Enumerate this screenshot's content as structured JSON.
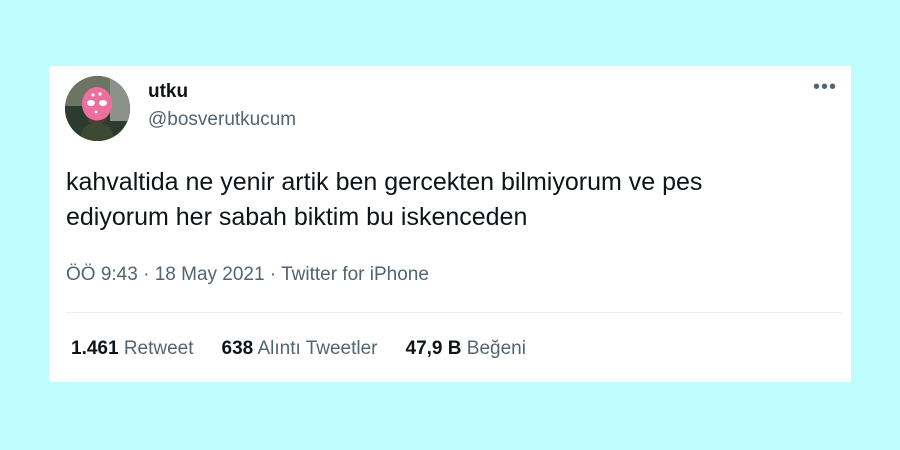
{
  "tweet": {
    "author_name": "utku",
    "author_handle": "@bosverutkucum",
    "more_icon": "more-horizontal-icon",
    "text_line1": "kahvaltida ne yenir artik ben gercekten bilmiyorum ve pes",
    "text_line2": "ediyorum her sabah biktim bu iskenceden",
    "timestamp": "ÖÖ 9:43 · 18 May 2021 · Twitter for iPhone",
    "stats": [
      {
        "count": "1.461",
        "label": "Retweet"
      },
      {
        "count": "638",
        "label": "Alıntı Tweetler"
      },
      {
        "count": "47,9 B",
        "label": "Beğeni"
      }
    ]
  },
  "colors": {
    "background": "#bffcfe",
    "card": "#ffffff",
    "text_primary": "#0f1419",
    "text_secondary": "#536471",
    "avatar_mask": "#ec6f9e"
  }
}
